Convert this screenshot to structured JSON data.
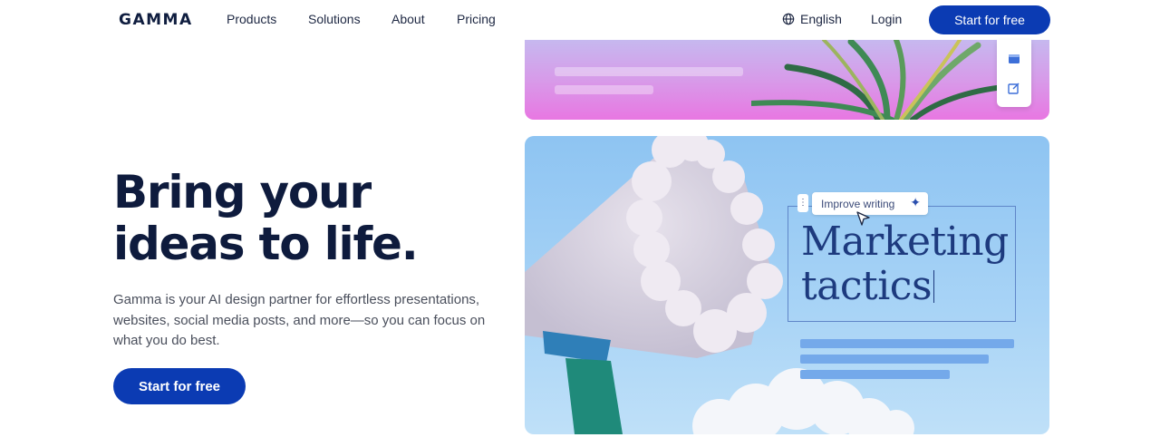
{
  "nav": {
    "logo": "GAMMA",
    "links": [
      "Products",
      "Solutions",
      "About",
      "Pricing"
    ],
    "language": "English",
    "login": "Login",
    "cta": "Start for free"
  },
  "hero": {
    "headline_line1": "Bring your",
    "headline_line2": "ideas to life.",
    "subtext": "Gamma is your AI design partner for effortless presentations, websites, social media posts, and more—so you can focus on what you do best.",
    "cta": "Start for free"
  },
  "preview": {
    "chip_label": "Improve writing",
    "title_line1": "Marketing",
    "title_line2": "tactics"
  },
  "colors": {
    "brand_blue": "#0b3bb3",
    "heading_navy": "#0e1b3d"
  }
}
